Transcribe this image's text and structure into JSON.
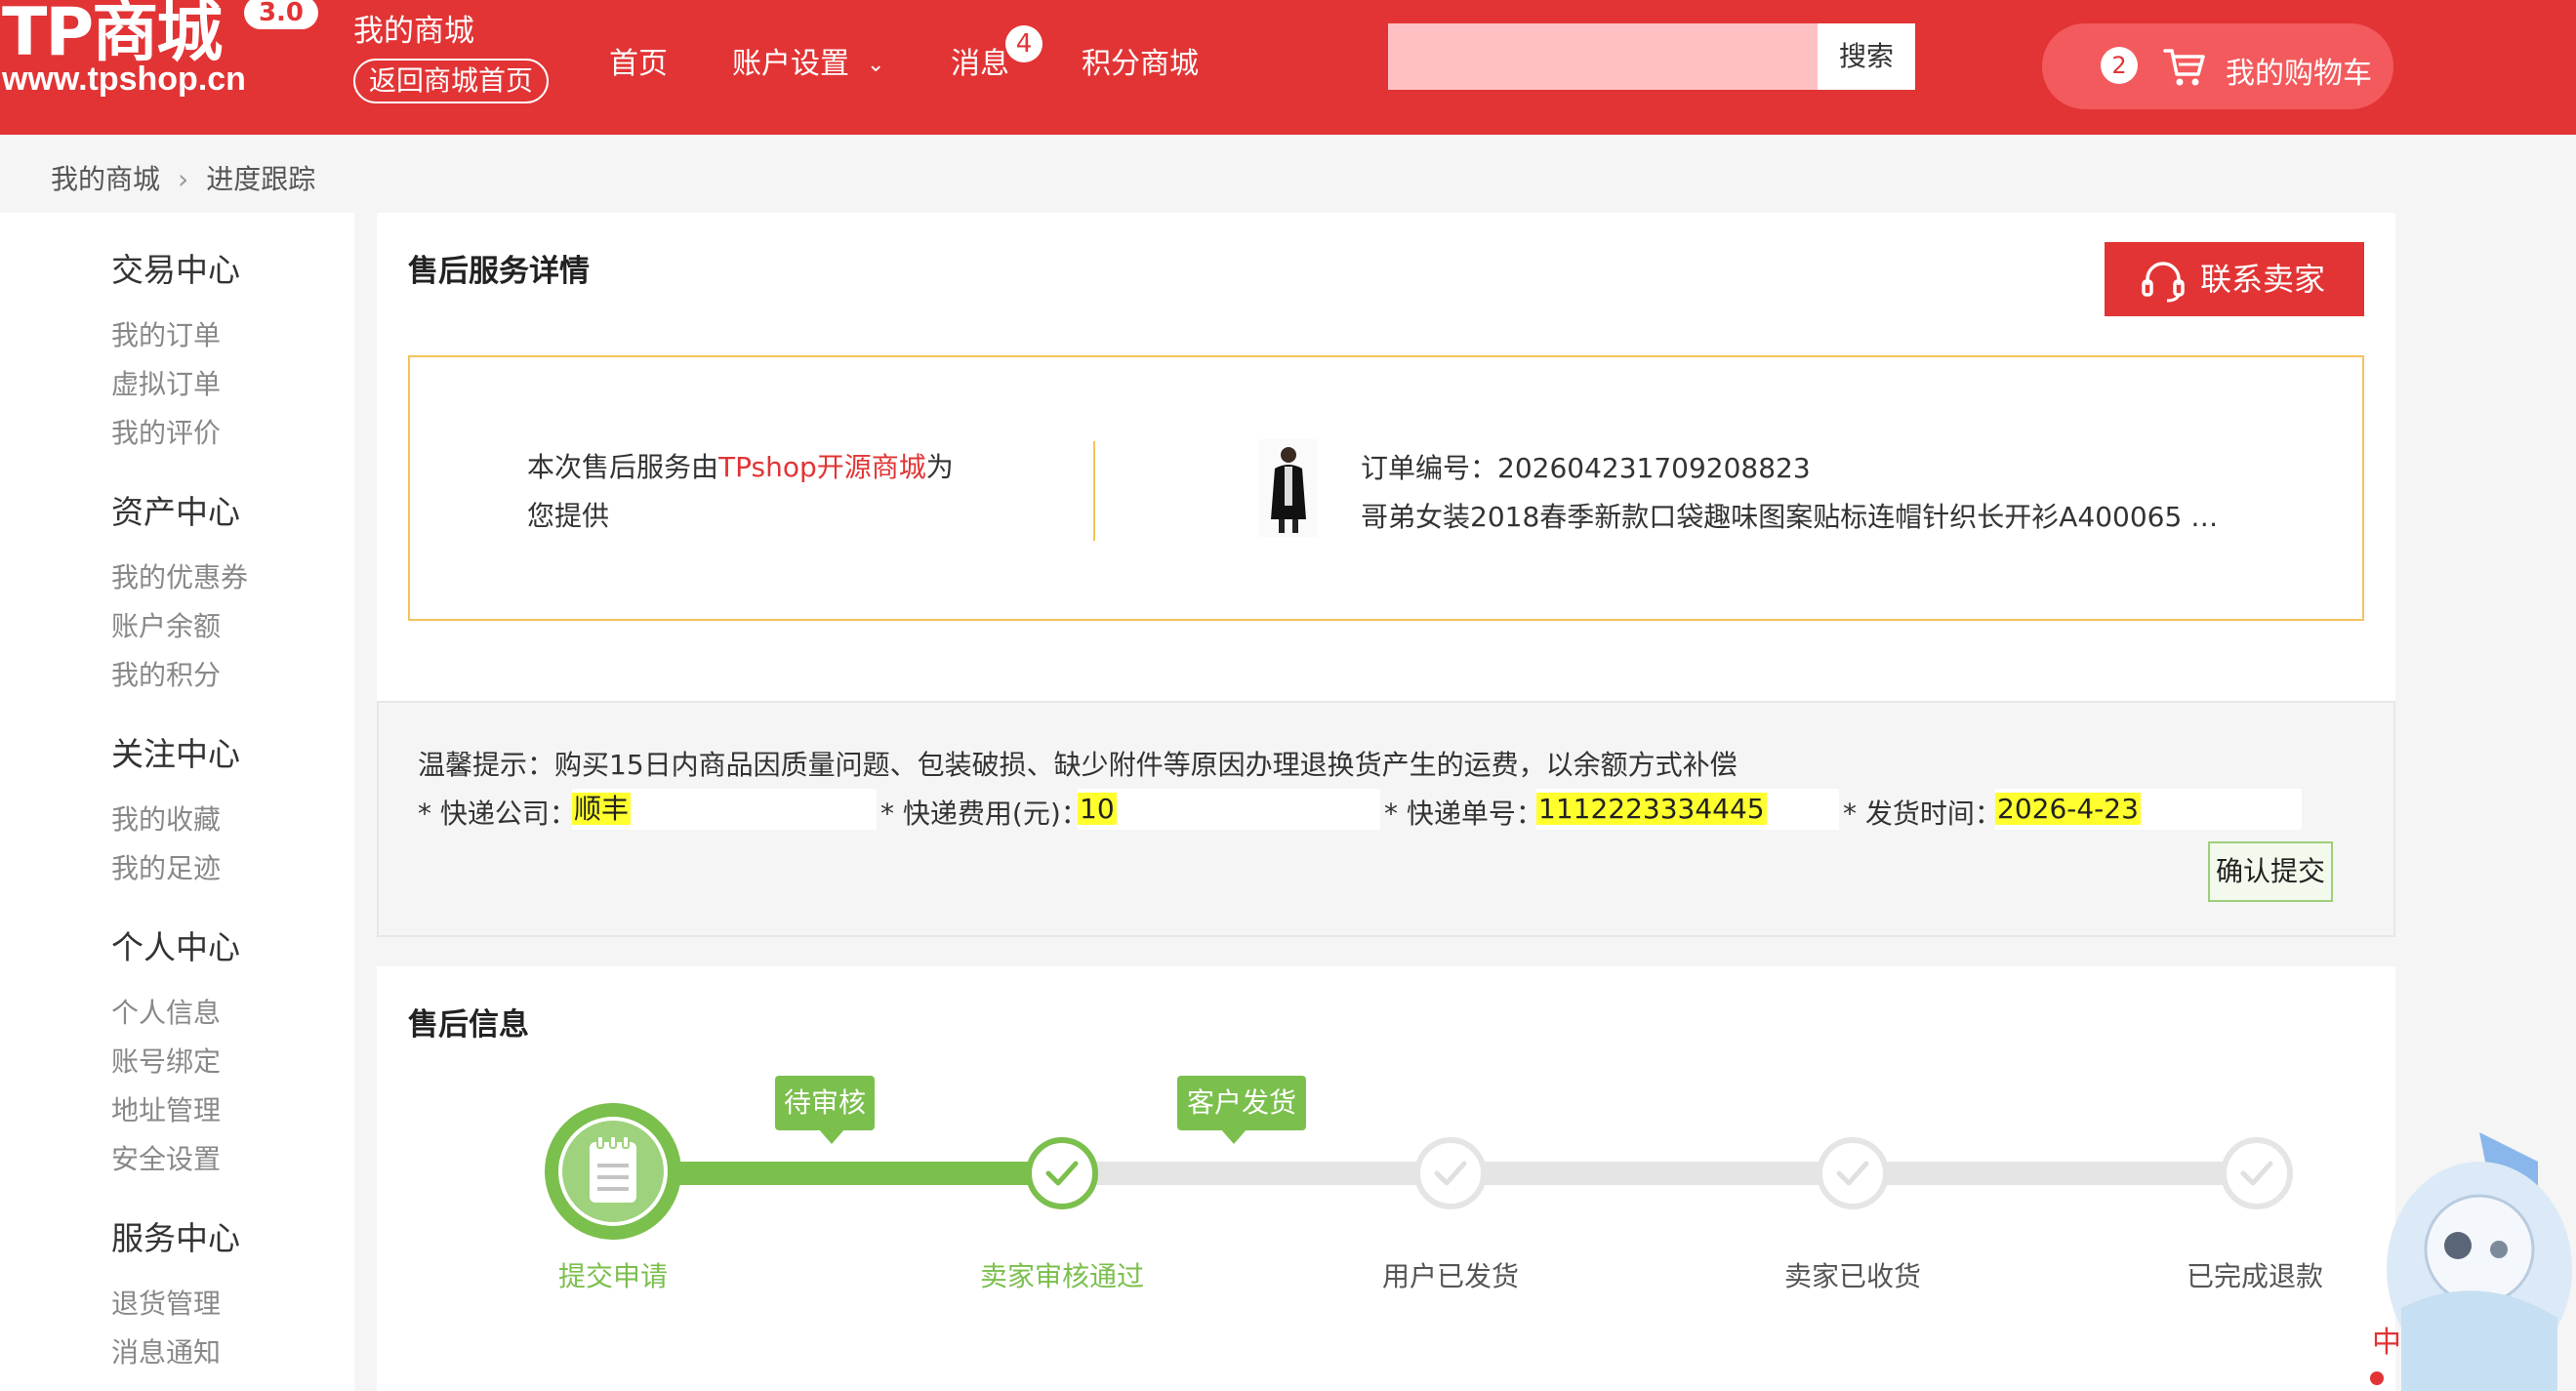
{
  "header": {
    "brand": "TP商城",
    "version": "3.0",
    "url": "www.tpshop.cn",
    "my_mall": "我的商城",
    "back_home": "返回商城首页",
    "nav": {
      "home": "首页",
      "account": "账户设置",
      "messages": "消息",
      "messages_count": "4",
      "points_mall": "积分商城"
    },
    "search": {
      "placeholder": "",
      "button": "搜索"
    },
    "cart": {
      "count": "2",
      "label": "我的购物车"
    },
    "accent_color": "#e23435"
  },
  "breadcrumb": [
    "我的商城",
    "进度跟踪"
  ],
  "sidebar": {
    "groups": [
      {
        "title": "交易中心",
        "items": [
          "我的订单",
          "虚拟订单",
          "我的评价"
        ]
      },
      {
        "title": "资产中心",
        "items": [
          "我的优惠券",
          "账户余额",
          "我的积分"
        ]
      },
      {
        "title": "关注中心",
        "items": [
          "我的收藏",
          "我的足迹"
        ]
      },
      {
        "title": "个人中心",
        "items": [
          "个人信息",
          "账号绑定",
          "地址管理",
          "安全设置"
        ]
      },
      {
        "title": "服务中心",
        "items": [
          "退货管理",
          "消息通知"
        ]
      }
    ]
  },
  "service_detail": {
    "title": "售后服务详情",
    "contact_button": "联系卖家",
    "provider_prefix": "本次售后服务由",
    "provider_name": "TPshop开源商城",
    "provider_suffix": "为您提供",
    "order_no_label": "订单编号：",
    "order_no": "202604231709208823",
    "goods_name": "哥弟女装2018春季新款口袋趣味图案贴标连帽针织长开衫A400065 …"
  },
  "shipping_form": {
    "tip_label": "温馨提示：",
    "tip_text": "购买15日内商品因质量问题、包装破损、缺少附件等原因办理退换货产生的运费，以余额方式补偿",
    "fields": [
      {
        "label": "* 快递公司：",
        "value": "顺丰"
      },
      {
        "label": "* 快递费用(元)：",
        "value": "10"
      },
      {
        "label": "* 快递单号：",
        "value": "1112223334445"
      },
      {
        "label": "* 发货时间：",
        "value": "2026-4-23"
      }
    ],
    "submit": "确认提交"
  },
  "aftersale_info": {
    "title": "售后信息",
    "steps": [
      "提交申请",
      "卖家审核通过",
      "用户已发货",
      "卖家已收货",
      "已完成退款"
    ],
    "tags": [
      "待审核",
      "客户发货"
    ],
    "active_color": "#7bbf4d",
    "inactive_color": "#e5e5e5"
  }
}
